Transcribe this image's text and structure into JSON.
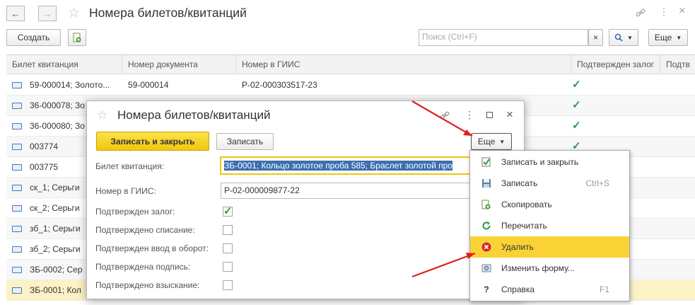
{
  "window": {
    "title": "Номера билетов/квитанций",
    "back_icon": "←",
    "forward_icon": "→"
  },
  "toolbar": {
    "create_label": "Создать",
    "search_placeholder": "Поиск (Ctrl+F)",
    "clear_icon": "×",
    "more_label": "Еще"
  },
  "table": {
    "columns": [
      "Билет квитанция",
      "Номер документа",
      "Номер в ГИИС",
      "Подтвержден залог",
      "Подтв"
    ],
    "rows": [
      {
        "ticket": "59-000014; Золото...",
        "doc": "59-000014",
        "giis": "Р-02-000303517-23",
        "pledge": "✓"
      },
      {
        "ticket": "36-000078; Зо",
        "doc": "",
        "giis": "",
        "pledge": "✓"
      },
      {
        "ticket": "36-000080; Зо",
        "doc": "",
        "giis": "",
        "pledge": "✓"
      },
      {
        "ticket": "003774",
        "doc": "",
        "giis": "",
        "pledge": "✓"
      },
      {
        "ticket": "003775",
        "doc": "",
        "giis": "",
        "pledge": ""
      },
      {
        "ticket": "ск_1; Серьги",
        "doc": "",
        "giis": "",
        "pledge": ""
      },
      {
        "ticket": "ск_2; Серьги",
        "doc": "",
        "giis": "",
        "pledge": ""
      },
      {
        "ticket": "зб_1; Серьги",
        "doc": "",
        "giis": "",
        "pledge": ""
      },
      {
        "ticket": "зб_2; Серьги",
        "doc": "",
        "giis": "",
        "pledge": ""
      },
      {
        "ticket": "ЗБ-0002; Сер",
        "doc": "",
        "giis": "",
        "pledge": ""
      },
      {
        "ticket": "ЗБ-0001; Кол",
        "doc": "",
        "giis": "",
        "pledge": ""
      }
    ]
  },
  "dialog": {
    "title": "Номера билетов/квитанций",
    "save_close_label": "Записать и закрыть",
    "save_label": "Записать",
    "more_label": "Еще",
    "ticket_label": "Билет квитанция:",
    "ticket_value": "ЗБ-0001; Кольцо золотое проба 585; Браслет золотой про",
    "giis_label": "Номер в ГИИС:",
    "giis_value": "Р-02-000009877-22",
    "checkboxes": [
      {
        "label": "Подтвержден залог:",
        "checked": true
      },
      {
        "label": "Подтверждено списание:",
        "checked": false
      },
      {
        "label": "Подтвержден ввод в оборот:",
        "checked": false
      },
      {
        "label": "Подтверждена подпись:",
        "checked": false
      },
      {
        "label": "Подтверждено взыскание:",
        "checked": false
      }
    ],
    "check_mark": "✓"
  },
  "menu": {
    "items": [
      {
        "label": "Записать и закрыть",
        "shortcut": "",
        "icon": "save-close-icon"
      },
      {
        "label": "Записать",
        "shortcut": "Ctrl+S",
        "icon": "floppy-icon"
      },
      {
        "label": "Скопировать",
        "shortcut": "",
        "icon": "copy-icon"
      },
      {
        "label": "Перечитать",
        "shortcut": "",
        "icon": "refresh-icon"
      },
      {
        "label": "Удалить",
        "shortcut": "",
        "icon": "delete-icon"
      },
      {
        "label": "Изменить форму...",
        "shortcut": "",
        "icon": "form-settings-icon"
      },
      {
        "label": "Справка",
        "shortcut": "F1",
        "icon": "help-icon"
      }
    ],
    "help_glyph": "?"
  },
  "colors": {
    "highlight": "#f9d336",
    "selected_row": "#fbf2c6",
    "check_green": "#2b9a3a",
    "arrow_red": "#e02020",
    "primary_button": "#f5d41f"
  }
}
